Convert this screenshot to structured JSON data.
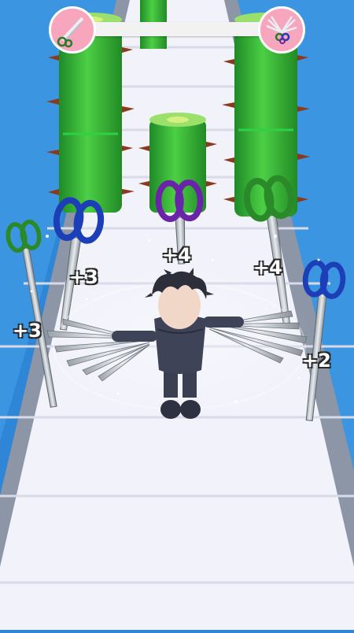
{
  "hud": {
    "level_start_icon": "scissors-icon",
    "level_end_icon": "scissors-bundle-icon",
    "progress": 0.0,
    "accent": "#f7a6bd"
  },
  "pickups": [
    {
      "label": "+3",
      "color": "#1c3fb8",
      "icon": "scissors-icon"
    },
    {
      "label": "+4",
      "color": "#6a24a8",
      "icon": "scissors-icon"
    },
    {
      "label": "+4",
      "color": "#2a8a2a",
      "icon": "scissors-icon"
    },
    {
      "label": "+3",
      "color": "#2a8a2a",
      "icon": "scissors-icon"
    },
    {
      "label": "+2",
      "color": "#1c3fb8",
      "icon": "scissors-icon"
    }
  ],
  "obstacles": [
    {
      "type": "spiked-cactus-column"
    },
    {
      "type": "spiked-cactus-column"
    },
    {
      "type": "spiked-cactus-column"
    },
    {
      "type": "spiked-cactus-column"
    }
  ],
  "colors": {
    "sky": "#2f86d6",
    "track": "#f2f2fb",
    "cactus": "#3db83d",
    "spike": "#8a3a1e"
  }
}
